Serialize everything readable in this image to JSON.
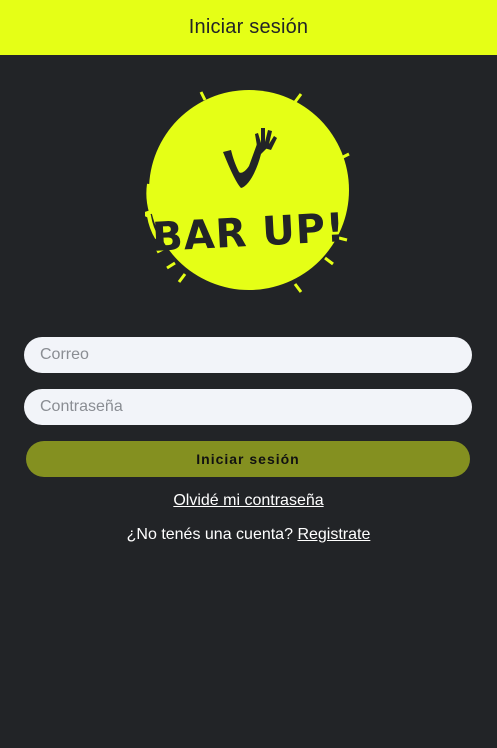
{
  "header": {
    "title": "Iniciar sesión"
  },
  "logo": {
    "text": "BAR UP!",
    "icon": "raised-hand-check-icon",
    "background_color": "#e5ff16",
    "text_color": "#222427"
  },
  "form": {
    "email_placeholder": "Correo",
    "email_value": "",
    "password_placeholder": "Contraseña",
    "password_value": "",
    "login_button_label": "Iniciar sesión",
    "forgot_password_label": "Olvidé mi contraseña",
    "no_account_text": "¿No tenés una cuenta?",
    "register_label": "Registrate"
  },
  "colors": {
    "accent": "#e5ff16",
    "background": "#222427",
    "button": "#849020",
    "input_background": "#f2f4f9"
  }
}
